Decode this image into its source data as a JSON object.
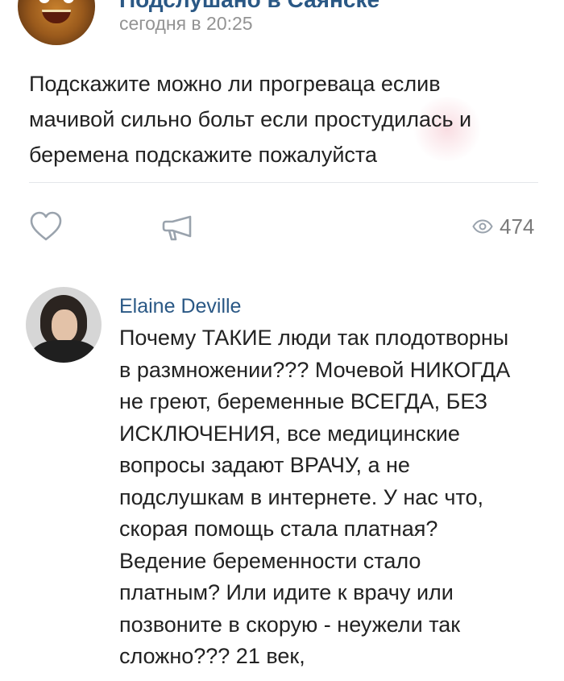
{
  "post": {
    "author": "Подслушано в Саянске",
    "time": "сегодня в 20:25",
    "text": "Подскажите можно ли прогреваца еслив мачивой сильно больт если простудилась и беремена подскажите пожалуйста",
    "views": "474"
  },
  "icons": {
    "like": "heart-icon",
    "share": "megaphone-icon",
    "views": "eye-icon"
  },
  "comment": {
    "author": "Elaine Deville",
    "text": "Почему ТАКИЕ люди так плодотворны в размножении??? Мочевой НИКОГДА не греют, беременные ВСЕГДА, БЕЗ ИСКЛЮЧЕНИЯ, все медицинские вопросы задают ВРАЧУ, а не подслушкам в интернете. У нас что, скорая помощь стала платная? Ведение беременности стало платным? Или идите к врачу или позвоните в скорую - неужели так сложно??? 21 век,"
  },
  "colors": {
    "link": "#2a5885",
    "muted": "#939393",
    "text": "#222222",
    "icon": "#9aa3ad"
  }
}
